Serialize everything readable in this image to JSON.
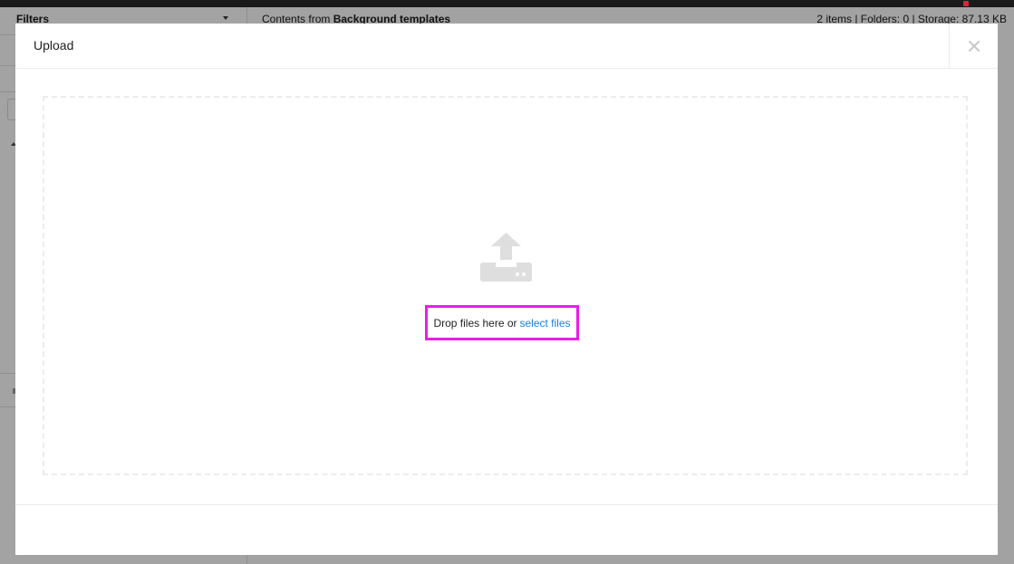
{
  "background": {
    "sidebar_title": "Filters",
    "contents_prefix": "Contents from",
    "contents_folder": "Background templates",
    "stats": "2 items | Folders: 0 | Storage: 87.13 KB"
  },
  "modal": {
    "title": "Upload",
    "close_icon": "close-icon",
    "dropzone": {
      "icon": "upload-icon",
      "text": "Drop files here or",
      "link": "select files"
    }
  },
  "colors": {
    "link": "#1a7fd6",
    "highlight": "#e81ee8",
    "icon": "#dedede"
  }
}
